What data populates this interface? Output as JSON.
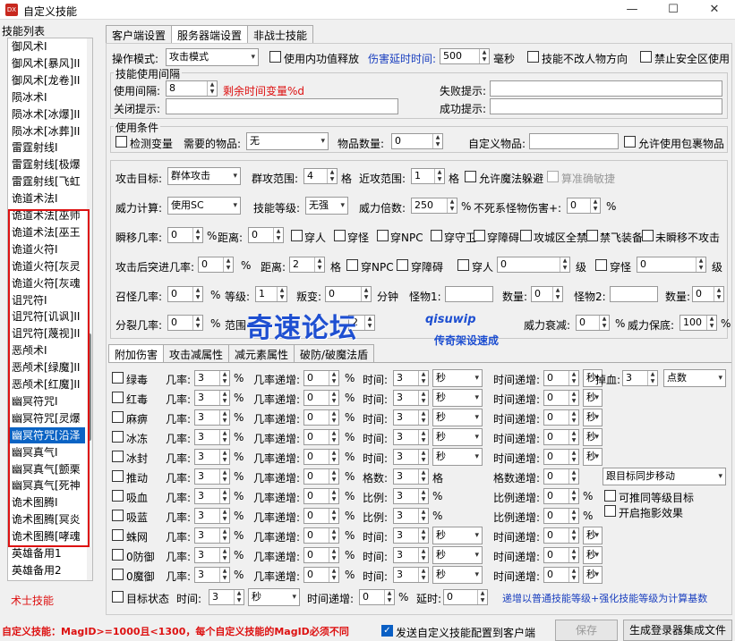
{
  "window": {
    "title": "自定义技能",
    "icon": "app-icon"
  },
  "left": {
    "list_title": "技能列表",
    "footer_label": "术士技能",
    "items": [
      "御风术I",
      "御风术[暴风]II",
      "御风术[龙卷]II",
      "陨冰术I",
      "陨冰术[冰爆]II",
      "陨冰术[冰葬]II",
      "雷霆射线I",
      "雷霆射线[极爆",
      "雷霆射线[飞虹",
      "诡道术法I",
      "诡道术法[巫师",
      "诡道术法[巫王",
      "诡道火符I",
      "诡道火符[灰灵",
      "诡道火符[灰魂",
      "诅咒符I",
      "诅咒符[讥讽]II",
      "诅咒符[蔑视]II",
      "恶颅术I",
      "恶颅术[绿魔]II",
      "恶颅术[红魔]II",
      "幽冥符咒I",
      "幽冥符咒[灵爆",
      "幽冥符咒[沿泽",
      "幽冥真气I",
      "幽冥真气[颤栗",
      "幽冥真气[死神",
      "诡术图腾I",
      "诡术图腾[冥炎",
      "诡术图腾[哮魂",
      "英雄备用1",
      "英雄备用2"
    ],
    "selected": "幽冥符咒[沿泽"
  },
  "tabs": [
    "客户端设置",
    "服务器端设置",
    "非战士技能"
  ],
  "row1": {
    "mode_label": "操作模式:",
    "mode_value": "攻击模式",
    "cb1": "使用内功值释放",
    "delay_label": "伤害延时时间:",
    "delay_value": "500",
    "ms": "毫秒",
    "cb2": "技能不改人物方向",
    "cb3": "禁止安全区使用"
  },
  "usage": {
    "title": "技能使用间隔",
    "interval_label": "使用间隔:",
    "interval_value": "8",
    "remain": "剩余时间变量%d",
    "fail": "失败提示:",
    "close": "关闭提示:",
    "success": "成功提示:"
  },
  "cond": {
    "title": "使用条件",
    "check": "检测变量",
    "need": "需要的物品:",
    "need_value": "无",
    "qty": "物品数量:",
    "qty_value": "0",
    "custom": "自定义物品:",
    "pack": "允许使用包裹物品"
  },
  "atk": {
    "target_l": "攻击目标:",
    "target_v": "群体攻击",
    "group_l": "群攻范围:",
    "group_v": "4",
    "ge": "格",
    "near_l": "近攻范围:",
    "near_v": "1",
    "ge2": "格",
    "dodge": "允许魔法躲避",
    "acc": "算准确敏捷"
  },
  "power": {
    "calc_l": "威力计算:",
    "calc_v": "使用SC",
    "lvl_l": "技能等级:",
    "lvl_v": "无强",
    "mult_l": "威力倍数:",
    "mult_v": "250",
    "pct": "%",
    "undead_l": "不死系怪物伤害+:",
    "undead_v": "0",
    "pct2": "%"
  },
  "tp": {
    "rate_l": "瞬移几率:",
    "rate_v": "0",
    "pct": "%",
    "dist_l": "距离:",
    "dist_v": "0",
    "opts": [
      "穿人",
      "穿怪",
      "穿NPC",
      "穿守卫",
      "穿障碍",
      "攻城区全禁",
      "禁飞装备",
      "未瞬移不攻击"
    ]
  },
  "rush": {
    "rate_l": "攻击后突进几率:",
    "rate_v": "0",
    "pct": "%",
    "dist_l": "距离:",
    "dist_v": "2",
    "ge": "格",
    "npc": "穿NPC",
    "obst": "穿障碍",
    "person": "穿人",
    "person_v": "0",
    "ji": "级",
    "mon": "穿怪",
    "mon_v": "0",
    "ji2": "级"
  },
  "summon": {
    "rate_l": "召怪几率:",
    "rate_v": "0",
    "pct": "%",
    "lvl_l": "等级:",
    "lvl_v": "1",
    "rebel_l": "叛变:",
    "rebel_v": "0",
    "min": "分钟",
    "m1": "怪物1:",
    "n1": "数量:",
    "n1_v": "0",
    "m2": "怪物2:",
    "n2": "数量:",
    "n2_v": "0"
  },
  "split": {
    "rate_l": "分裂几率:",
    "rate_v": "0",
    "pct": "%",
    "range_l": "范围",
    "n_v": "2",
    "decay_l": "威力衰减:",
    "decay_v": "0",
    "pct2": "%",
    "floor_l": "威力保底:",
    "floor_v": "100",
    "pct3": "%"
  },
  "watermark": {
    "main": "奇速论坛",
    "url": "qisuwip",
    "sub": "传奇架设速成"
  },
  "subtabs": [
    "附加伤害",
    "攻击减属性",
    "减元素属性",
    "破防/破魔法盾"
  ],
  "effects": [
    {
      "name": "绿毒",
      "type": "rate"
    },
    {
      "name": "红毒",
      "type": "rate"
    },
    {
      "name": "麻痹",
      "type": "rate"
    },
    {
      "name": "冰冻",
      "type": "rate"
    },
    {
      "name": "冰封",
      "type": "rate"
    },
    {
      "name": "推动",
      "type": "cells"
    },
    {
      "name": "吸血",
      "type": "ratio"
    },
    {
      "name": "吸蓝",
      "type": "ratio"
    },
    {
      "name": "蛛网",
      "type": "rate"
    },
    {
      "name": "0防御",
      "type": "rate"
    },
    {
      "name": "0魔御",
      "type": "rate"
    }
  ],
  "eff_labels": {
    "rate": "几率:",
    "rate_v": "3",
    "rate_inc": "几率递增:",
    "rate_inc_v": "0",
    "time": "时间:",
    "time_v": "3",
    "unit": "秒",
    "time_inc": "时间递增:",
    "time_inc_v": "0",
    "cells": "格数:",
    "cells_v": "3",
    "ge": "格",
    "cells_inc": "格数递增:",
    "cells_inc_v": "0",
    "ratio": "比例:",
    "ratio_v": "3",
    "ratio_inc": "比例递增:",
    "ratio_inc_v": "0",
    "pct": "%"
  },
  "right_extra": {
    "drop_l": "掉血:",
    "drop_v": "3",
    "drop_unit": "点数",
    "follow": "跟目标同步移动",
    "push_same": "可推同等级目标",
    "drag": "开启拖影效果"
  },
  "target_state": {
    "label": "目标状态",
    "time_l": "时间:",
    "time_v": "3",
    "unit": "秒",
    "inc_l": "时间递增:",
    "inc_v": "0",
    "pct": "%",
    "delay_l": "延时:",
    "delay_v": "0",
    "note": "递增以普通技能等级+强化技能等级为计算基数"
  },
  "bottom": {
    "note": "自定义技能：MagID>=1000且<1300，每个自定义技能的MagID必须不同",
    "send": "发送自定义技能配置到客户端",
    "save": "保存",
    "gen": "生成登录器集成文件"
  }
}
